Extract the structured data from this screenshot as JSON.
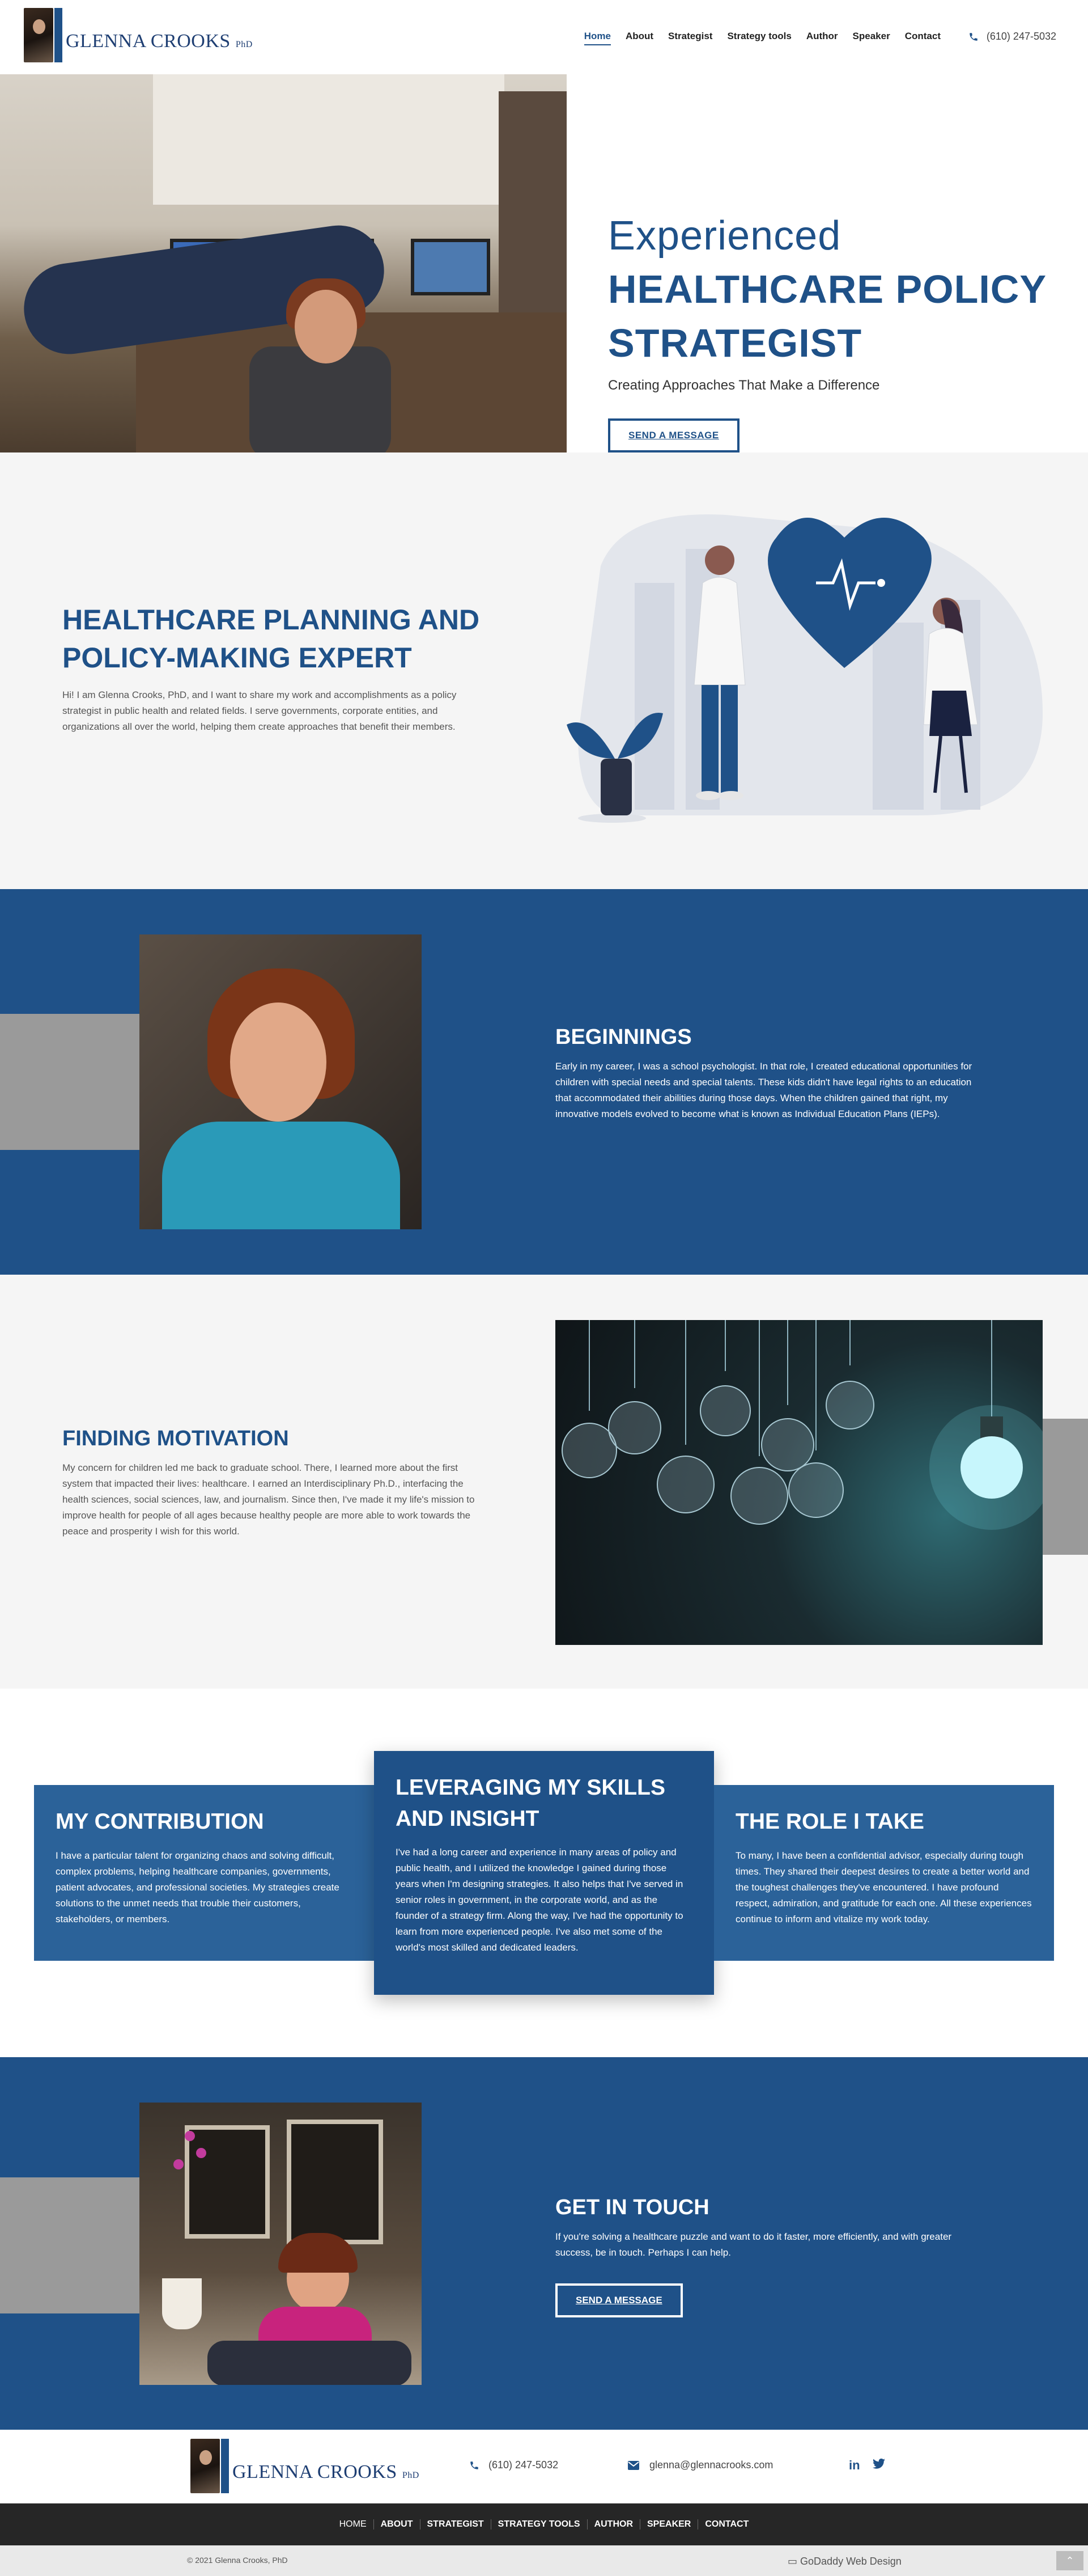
{
  "header": {
    "logo_name": "GLENNA CROOKS",
    "logo_suffix": "PhD",
    "nav": [
      "Home",
      "About",
      "Strategist",
      "Strategy tools",
      "Author",
      "Speaker",
      "Contact"
    ],
    "phone": "(610) 247-5032"
  },
  "hero": {
    "line1": "Experienced",
    "line2": "HEALTHCARE POLICY",
    "line3": "STRATEGIST",
    "subtitle": "Creating Approaches That Make a Difference",
    "button": "SEND A MESSAGE"
  },
  "expert": {
    "heading_line1": "HEALTHCARE PLANNING AND",
    "heading_line2": "POLICY-MAKING EXPERT",
    "body": "Hi! I am Glenna Crooks, PhD, and I want to share my work and accomplishments as a policy strategist in public health and related fields. I serve governments, corporate entities, and organizations all over the world, helping them create approaches that benefit their members."
  },
  "beginnings": {
    "heading": "BEGINNINGS",
    "body": "Early in my career, I was a school psychologist. In that role, I created educational opportunities for children with special needs and special talents. These kids didn't have legal rights to an education that accommodated their abilities during those days. When the children gained that right, my innovative models evolved to become what is known as Individual Education Plans (IEPs)."
  },
  "motivation": {
    "heading": "FINDING MOTIVATION",
    "body": "My concern for children led me back to graduate school. There, I learned more about the first system that impacted their lives: healthcare. I earned an Interdisciplinary Ph.D., interfacing the health sciences, social sciences, law, and journalism. Since then, I've made it my life's mission to improve health for people of all ages because healthy people are more able to work towards the peace and prosperity I wish for this world."
  },
  "cards": [
    {
      "heading": "MY CONTRIBUTION",
      "body": "I have a particular talent for organizing chaos and solving difficult, complex problems, helping healthcare companies, governments, patient advocates, and professional societies. My strategies create solutions to the unmet needs that trouble their customers, stakeholders, or members."
    },
    {
      "heading": "LEVERAGING MY SKILLS AND INSIGHT",
      "body": "I've had a long career and experience in many areas of policy and public health, and I utilized the knowledge I gained during those years when I'm designing strategies. It also helps that I've served in senior roles in government, in the corporate world, and as the founder of a strategy firm. Along the way, I've had the opportunity to learn from more experienced people. I've also met some of the world's most skilled and dedicated leaders."
    },
    {
      "heading": "THE ROLE I TAKE",
      "body": "To many, I have been a confidential advisor, especially during tough times. They shared their deepest desires to create a better world and the toughest challenges they've encountered. I have profound respect, admiration, and gratitude for each one. All these experiences continue to inform and vitalize my work today."
    }
  ],
  "touch": {
    "heading": "GET IN TOUCH",
    "body": "If you're solving a healthcare puzzle and want to do it faster, more efficiently, and with greater success, be in touch. Perhaps I can help.",
    "button": "SEND A MESSAGE"
  },
  "footer": {
    "phone": "(610) 247-5032",
    "email": "glenna@glennacrooks.com",
    "social": [
      "in",
      "twitter"
    ],
    "nav": [
      "HOME",
      "ABOUT",
      "STRATEGIST",
      "STRATEGY TOOLS",
      "AUTHOR",
      "SPEAKER",
      "CONTACT"
    ],
    "copyright": "© 2021 Glenna Crooks, PhD",
    "credit": "GoDaddy Web Design"
  },
  "colors": {
    "navy": "#1f5188",
    "light_bg": "#f5f5f5",
    "dark_footer": "#262626"
  }
}
